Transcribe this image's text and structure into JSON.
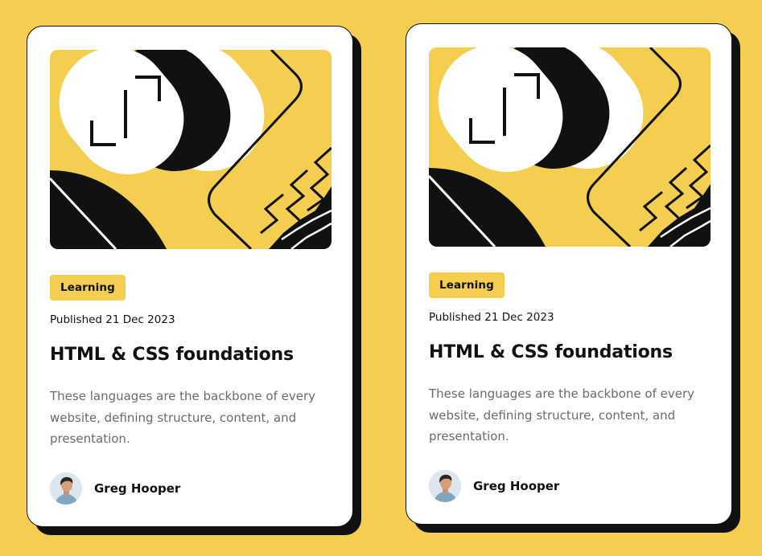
{
  "colors": {
    "background": "#F4CE50",
    "card": "#FFFFFF",
    "ink": "#111111",
    "muted_text": "#6B6B6B",
    "tag": "#F4CE50"
  },
  "cards": [
    {
      "illustration_icon": "abstract-illustration",
      "tag": "Learning",
      "published": "Published 21 Dec 2023",
      "title": "HTML & CSS foundations",
      "description": "These languages are the backbone of every website, defining structure, content, and presentation.",
      "author": {
        "name": "Greg Hooper",
        "avatar_icon": "avatar-photo"
      }
    },
    {
      "illustration_icon": "abstract-illustration",
      "tag": "Learning",
      "published": "Published 21 Dec 2023",
      "title": "HTML & CSS foundations",
      "description": "These languages are the backbone of every website, defining structure, content, and presentation.",
      "author": {
        "name": "Greg Hooper",
        "avatar_icon": "avatar-photo"
      }
    }
  ]
}
